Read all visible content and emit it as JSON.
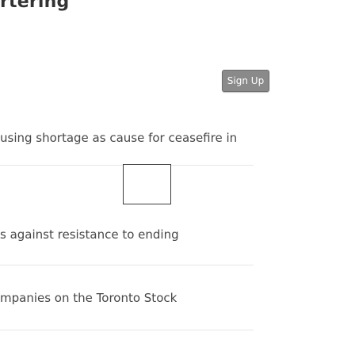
{
  "header": {
    "site_title_fragment": "rtering",
    "signup_label": "Sign Up"
  },
  "headlines": [
    {
      "text": "using shortage as cause for ceasefire in"
    },
    {
      "text": "s against resistance to ending"
    },
    {
      "text": "mpanies on the Toronto Stock"
    }
  ],
  "colors": {
    "button_background": "#8a8a8a",
    "button_text": "#ffffff",
    "headline_text": "#474747"
  }
}
